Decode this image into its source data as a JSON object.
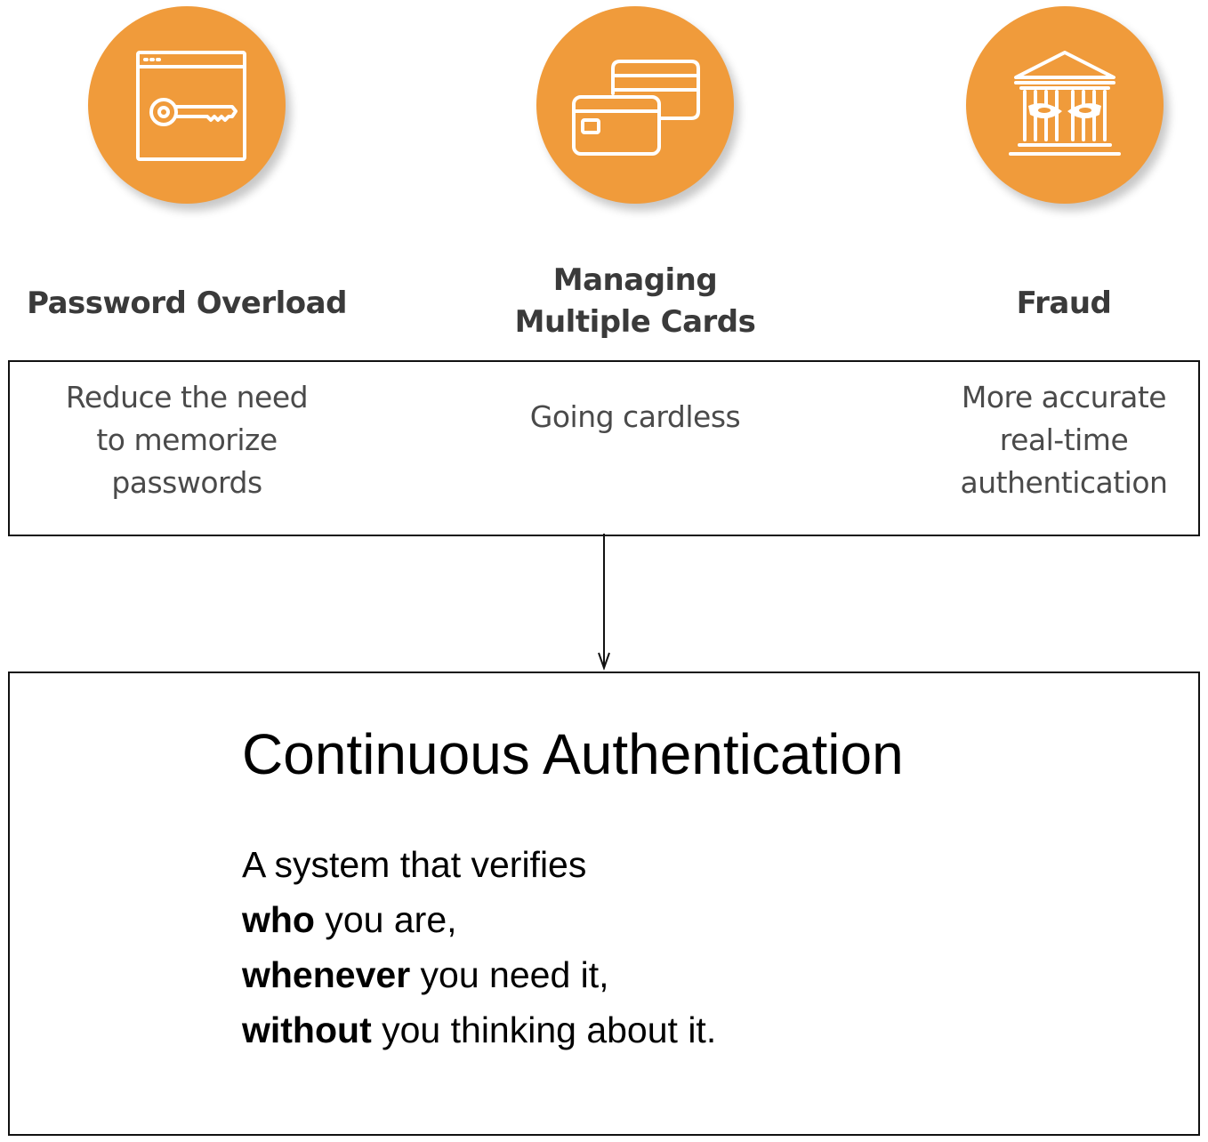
{
  "colors": {
    "accent": "#F09B3B",
    "icon_stroke": "#FFFFFF",
    "border": "#111111",
    "heading_text": "#3A3A3A",
    "benefit_text": "#4A4A4A"
  },
  "problems": [
    {
      "icon": "password-window-key-icon",
      "title_lines": [
        "Password Overload"
      ],
      "benefit_lines": [
        "Reduce the need",
        "to memorize",
        "passwords"
      ]
    },
    {
      "icon": "credit-cards-icon",
      "title_lines": [
        "Managing",
        "Multiple Cards"
      ],
      "benefit_lines": [
        "Going cardless"
      ]
    },
    {
      "icon": "bank-robber-mask-icon",
      "title_lines": [
        "Fraud"
      ],
      "benefit_lines": [
        "More accurate",
        "real-time",
        "authentication"
      ]
    }
  ],
  "solution": {
    "title": "Continuous Authentication",
    "line1": "A system that verifies",
    "line2_bold": "who",
    "line2_rest": " you are,",
    "line3_bold": "whenever",
    "line3_rest": " you need it,",
    "line4_bold": "without",
    "line4_rest": " you thinking about it."
  }
}
